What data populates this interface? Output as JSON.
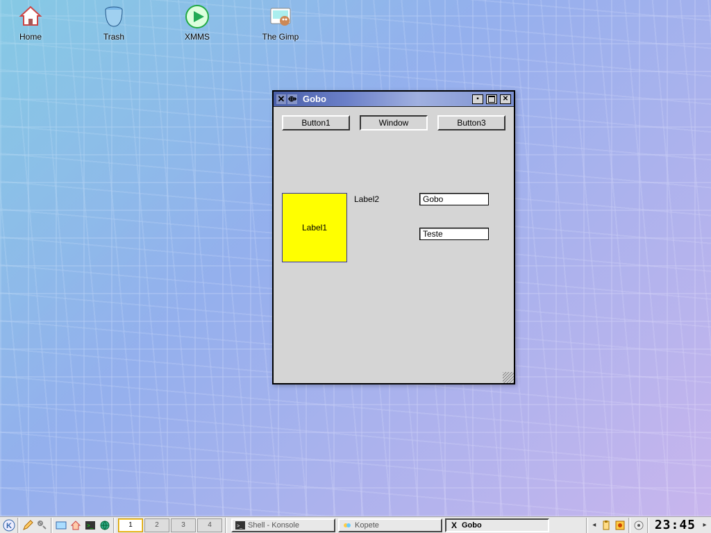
{
  "desktop": {
    "icons": [
      {
        "name": "home-icon",
        "label": "Home"
      },
      {
        "name": "trash-icon",
        "label": "Trash"
      },
      {
        "name": "xmms-icon",
        "label": "XMMS"
      },
      {
        "name": "gimp-icon",
        "label": "The Gimp"
      }
    ]
  },
  "window": {
    "title": "Gobo",
    "buttons": {
      "b1": "Button1",
      "b2": "Window",
      "b3": "Button3"
    },
    "label1": "Label1",
    "label2": "Label2",
    "input1_value": "Gobo",
    "input2_value": "Teste"
  },
  "taskbar": {
    "pager": {
      "active": 1,
      "cells": [
        "1",
        "2",
        "3",
        "4"
      ]
    },
    "tasks": [
      {
        "label": "Shell - Konsole",
        "icon": "terminal-icon",
        "active": false
      },
      {
        "label": "Kopete",
        "icon": "kopete-icon",
        "active": false
      },
      {
        "label": "Gobo",
        "icon": "x-app-icon",
        "active": true
      }
    ],
    "clock": "23:45"
  }
}
